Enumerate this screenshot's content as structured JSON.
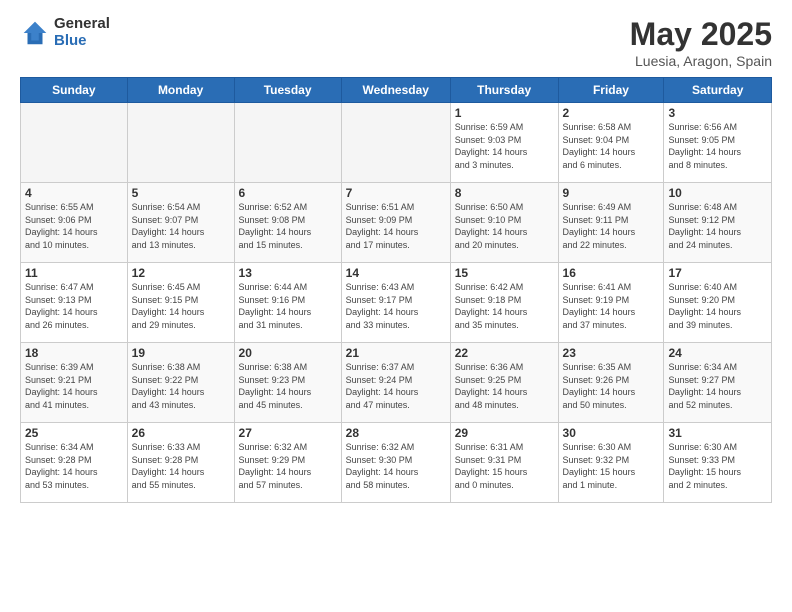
{
  "header": {
    "logo_general": "General",
    "logo_blue": "Blue",
    "title": "May 2025",
    "subtitle": "Luesia, Aragon, Spain"
  },
  "calendar": {
    "days_of_week": [
      "Sunday",
      "Monday",
      "Tuesday",
      "Wednesday",
      "Thursday",
      "Friday",
      "Saturday"
    ],
    "weeks": [
      [
        {
          "day": "",
          "info": ""
        },
        {
          "day": "",
          "info": ""
        },
        {
          "day": "",
          "info": ""
        },
        {
          "day": "",
          "info": ""
        },
        {
          "day": "1",
          "info": "Sunrise: 6:59 AM\nSunset: 9:03 PM\nDaylight: 14 hours\nand 3 minutes."
        },
        {
          "day": "2",
          "info": "Sunrise: 6:58 AM\nSunset: 9:04 PM\nDaylight: 14 hours\nand 6 minutes."
        },
        {
          "day": "3",
          "info": "Sunrise: 6:56 AM\nSunset: 9:05 PM\nDaylight: 14 hours\nand 8 minutes."
        }
      ],
      [
        {
          "day": "4",
          "info": "Sunrise: 6:55 AM\nSunset: 9:06 PM\nDaylight: 14 hours\nand 10 minutes."
        },
        {
          "day": "5",
          "info": "Sunrise: 6:54 AM\nSunset: 9:07 PM\nDaylight: 14 hours\nand 13 minutes."
        },
        {
          "day": "6",
          "info": "Sunrise: 6:52 AM\nSunset: 9:08 PM\nDaylight: 14 hours\nand 15 minutes."
        },
        {
          "day": "7",
          "info": "Sunrise: 6:51 AM\nSunset: 9:09 PM\nDaylight: 14 hours\nand 17 minutes."
        },
        {
          "day": "8",
          "info": "Sunrise: 6:50 AM\nSunset: 9:10 PM\nDaylight: 14 hours\nand 20 minutes."
        },
        {
          "day": "9",
          "info": "Sunrise: 6:49 AM\nSunset: 9:11 PM\nDaylight: 14 hours\nand 22 minutes."
        },
        {
          "day": "10",
          "info": "Sunrise: 6:48 AM\nSunset: 9:12 PM\nDaylight: 14 hours\nand 24 minutes."
        }
      ],
      [
        {
          "day": "11",
          "info": "Sunrise: 6:47 AM\nSunset: 9:13 PM\nDaylight: 14 hours\nand 26 minutes."
        },
        {
          "day": "12",
          "info": "Sunrise: 6:45 AM\nSunset: 9:15 PM\nDaylight: 14 hours\nand 29 minutes."
        },
        {
          "day": "13",
          "info": "Sunrise: 6:44 AM\nSunset: 9:16 PM\nDaylight: 14 hours\nand 31 minutes."
        },
        {
          "day": "14",
          "info": "Sunrise: 6:43 AM\nSunset: 9:17 PM\nDaylight: 14 hours\nand 33 minutes."
        },
        {
          "day": "15",
          "info": "Sunrise: 6:42 AM\nSunset: 9:18 PM\nDaylight: 14 hours\nand 35 minutes."
        },
        {
          "day": "16",
          "info": "Sunrise: 6:41 AM\nSunset: 9:19 PM\nDaylight: 14 hours\nand 37 minutes."
        },
        {
          "day": "17",
          "info": "Sunrise: 6:40 AM\nSunset: 9:20 PM\nDaylight: 14 hours\nand 39 minutes."
        }
      ],
      [
        {
          "day": "18",
          "info": "Sunrise: 6:39 AM\nSunset: 9:21 PM\nDaylight: 14 hours\nand 41 minutes."
        },
        {
          "day": "19",
          "info": "Sunrise: 6:38 AM\nSunset: 9:22 PM\nDaylight: 14 hours\nand 43 minutes."
        },
        {
          "day": "20",
          "info": "Sunrise: 6:38 AM\nSunset: 9:23 PM\nDaylight: 14 hours\nand 45 minutes."
        },
        {
          "day": "21",
          "info": "Sunrise: 6:37 AM\nSunset: 9:24 PM\nDaylight: 14 hours\nand 47 minutes."
        },
        {
          "day": "22",
          "info": "Sunrise: 6:36 AM\nSunset: 9:25 PM\nDaylight: 14 hours\nand 48 minutes."
        },
        {
          "day": "23",
          "info": "Sunrise: 6:35 AM\nSunset: 9:26 PM\nDaylight: 14 hours\nand 50 minutes."
        },
        {
          "day": "24",
          "info": "Sunrise: 6:34 AM\nSunset: 9:27 PM\nDaylight: 14 hours\nand 52 minutes."
        }
      ],
      [
        {
          "day": "25",
          "info": "Sunrise: 6:34 AM\nSunset: 9:28 PM\nDaylight: 14 hours\nand 53 minutes."
        },
        {
          "day": "26",
          "info": "Sunrise: 6:33 AM\nSunset: 9:28 PM\nDaylight: 14 hours\nand 55 minutes."
        },
        {
          "day": "27",
          "info": "Sunrise: 6:32 AM\nSunset: 9:29 PM\nDaylight: 14 hours\nand 57 minutes."
        },
        {
          "day": "28",
          "info": "Sunrise: 6:32 AM\nSunset: 9:30 PM\nDaylight: 14 hours\nand 58 minutes."
        },
        {
          "day": "29",
          "info": "Sunrise: 6:31 AM\nSunset: 9:31 PM\nDaylight: 15 hours\nand 0 minutes."
        },
        {
          "day": "30",
          "info": "Sunrise: 6:30 AM\nSunset: 9:32 PM\nDaylight: 15 hours\nand 1 minute."
        },
        {
          "day": "31",
          "info": "Sunrise: 6:30 AM\nSunset: 9:33 PM\nDaylight: 15 hours\nand 2 minutes."
        }
      ]
    ]
  }
}
